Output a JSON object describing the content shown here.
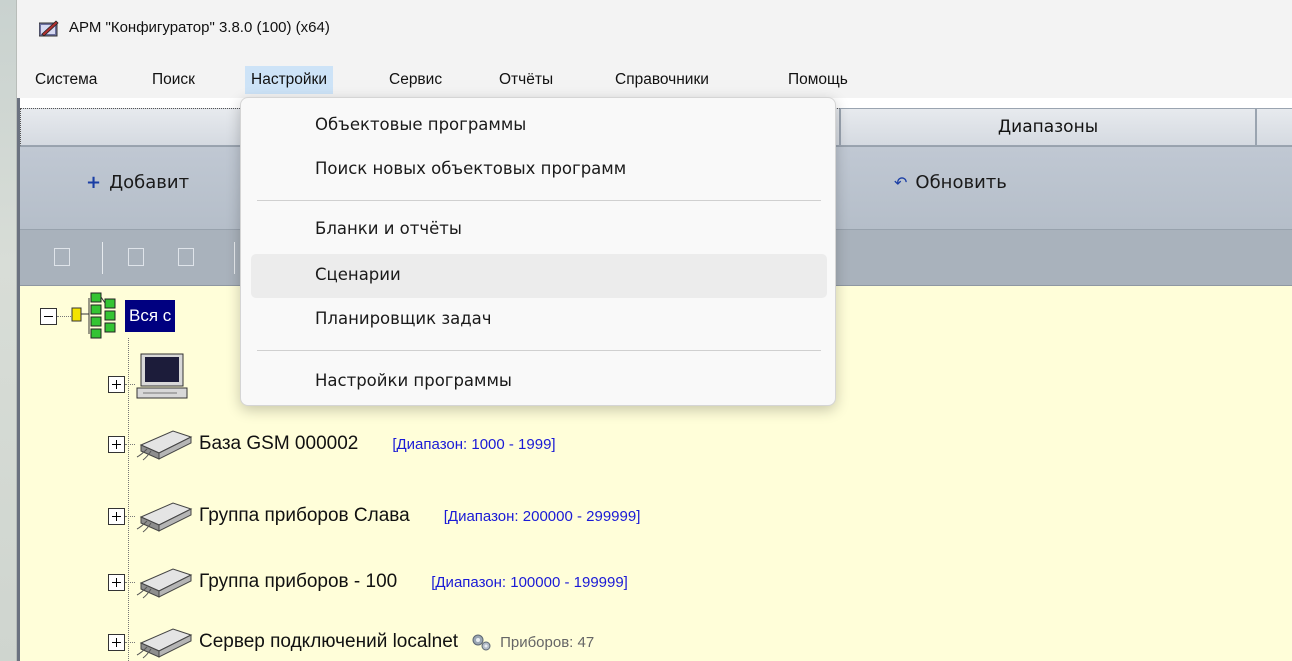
{
  "window": {
    "title": "АРМ \"Конфигуратор\"  3.8.0 (100)  (x64)",
    "icon": "app-pencil-icon"
  },
  "menubar": {
    "items": [
      {
        "label": "Система"
      },
      {
        "label": "Поиск"
      },
      {
        "label": "Настройки",
        "active": true
      },
      {
        "label": "Сервис"
      },
      {
        "label": "Отчёты"
      },
      {
        "label": "Справочники"
      },
      {
        "label": "Помощь"
      }
    ]
  },
  "tabs": [
    {
      "label": ""
    },
    {
      "label": "Диапазоны"
    },
    {
      "label": ""
    }
  ],
  "toolbar": {
    "add_label": "Добавит",
    "add_icon": "plus-icon",
    "refresh_label": "Обновить",
    "refresh_icon": "undo-icon"
  },
  "dropdown": {
    "items": [
      {
        "label": "Объектовые программы"
      },
      {
        "label": "Поиск новых объектовых программ"
      },
      {
        "label": "Бланки и отчёты"
      },
      {
        "label": "Сценарии",
        "hover": true
      },
      {
        "label": "Планировщик задач"
      },
      {
        "label": "Настройки программы"
      }
    ]
  },
  "tree": {
    "root": {
      "label": "Вся с",
      "icon": "network-tree-icon",
      "expanded": true
    },
    "children": [
      {
        "label": "",
        "icon": "computer-icon"
      },
      {
        "label": "База GSM 000002",
        "range": "[Диапазон: 1000 - 1999]",
        "icon": "device-icon"
      },
      {
        "label": "Группа приборов Слава",
        "range": "[Диапазон: 200000 - 299999]",
        "icon": "device-icon"
      },
      {
        "label": "Группа приборов - 100",
        "range": "[Диапазон: 100000 - 199999]",
        "icon": "device-icon"
      },
      {
        "label": "Сервер подключений localnet",
        "devices": "Приборов: 47",
        "icon": "device-icon"
      }
    ]
  },
  "colors": {
    "selection": "#000080",
    "range_text": "#1a1ad6",
    "tree_bg": "#fffed9",
    "menu_active": "#cde3f7"
  }
}
